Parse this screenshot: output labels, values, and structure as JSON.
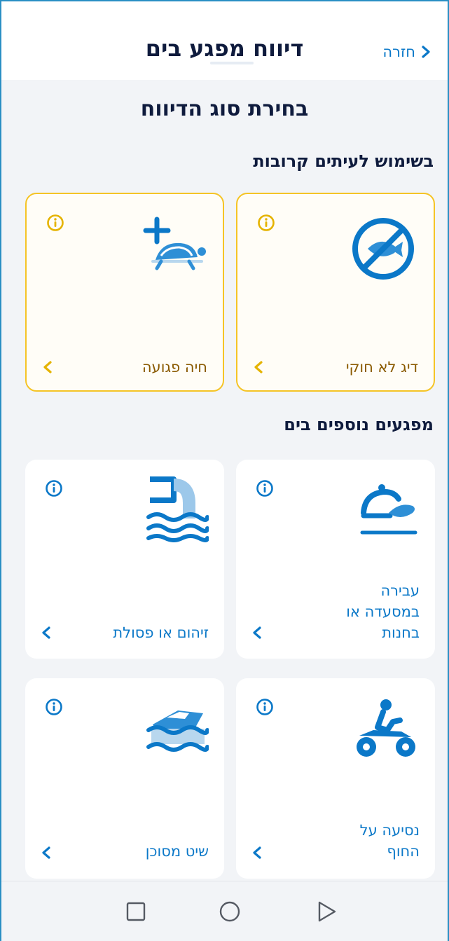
{
  "header": {
    "title": "דיווח מפגע בים",
    "back_label": "חזרה"
  },
  "page": {
    "heading": "בחירת סוג הדיווח"
  },
  "sections": {
    "coming_soon": "בשימוש לעיתים קרובות",
    "more": "מפגעים נוספים בים"
  },
  "cards": {
    "illegal_fishing": "דיג לא חוקי",
    "injured_animal": "חיה פגועה",
    "restaurant_violation": "עבירה\nבמסעדה או\nבחנות",
    "pollution": "זיהום או פסולת",
    "beach_driving": "נסיעה על\nהחוף",
    "dangerous_boat": "שיט מסוכן"
  },
  "colors": {
    "accent_blue": "#0b78c8",
    "soon_yellow": "#f5c426",
    "soon_text": "#8a5a00",
    "title_dark": "#0f1b3d"
  },
  "icons": {
    "back": "chevron-right-icon",
    "info": "info-circle-icon",
    "card_arrow": "chevron-left-icon",
    "nav_recent": "square-icon",
    "nav_home": "circle-icon",
    "nav_back": "triangle-icon"
  }
}
